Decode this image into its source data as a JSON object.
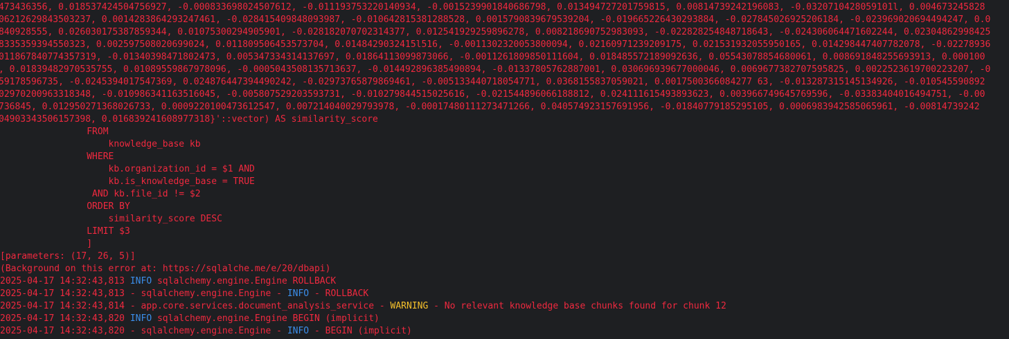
{
  "colors": {
    "background": "#1e1f22",
    "error_text": "#f0293f",
    "info": "#3b8eea",
    "warning": "#f5c02b"
  },
  "vector_lines": [
    "473436356, 0.018537424504756927, -0.000833698024507612, -0.011193753220140934, -0.0015239901840686798, 0.013494727201759815, 0.00814739242196083, -0.0320710428059101l, 0.004673245828",
    "06212629843503237, 0.0014283864293247461, -0.028415409848093987, -0.010642815381288528, 0.0015790839679539204, -0.019665226430293884, -0.027845026925206184, -0.023969020694494247, 0.0",
    "840928555, 0.026030175387859344, 0.01075300294905901, -0.028182070702314377, 0.012541929259896278, 0.008218690752983093, -0.022828254848718643, -0.024306064471602244, 0.02304862998425",
    "8335359394550323, 0.002597508020699024, 0.011809506453573704, 0.0148429032415l516, -0.0011302320053800094, 0.021609712392091‍75, 0.021531932055950165, 0.014298447407782078, -0.02278936",
    "011867840774357319, -0.01340398471802473, 0.005347334314137697, 0.0186411309987306‍6, -0.0011261809850111604, 0.018485572189092636, 0.05543078854680061, 0.008691848255693913, 0.000100",
    ", 0.01839482970535755, 0.01089559867978096, -0.0005043508135713637, -0.014492896385490894, -0.01337805762887001, 0.030696939677000046, 0.0069677382707595825, 0.0022523619700223207, -0",
    "59178596735, -0.0245394017547369, 0.024876447394490242, -0.02973765879869461, -0.005133440718054771, 0.0368155837059021, 0.0017500366084277 63, -0.013287315145134926, -0.010545590892",
    "02970200963318348, -0.010986341163516045, -0.005807529203593731, -0.010279844515025616, -0.021544896066188812, 0.024111615493893623, 0.003966749645769596, -0.03383404016494751, -0.00",
    "736845, 0.012950271368026733, 0.0009220100473612547, 0.007214040029793978, -0.00017480111273471266, 0.040574923157691956, -0.01840779185295105, 0.0006983942585065961, -0.00814739242",
    "04903343506157398, 0.016839241608977318}'::vector) AS similarity_score"
  ],
  "sql_lines": [
    "                FROM",
    "                    knowledge_base kb",
    "                WHERE",
    "                    kb.organization_id = $1 AND",
    "                    kb.is_knowledge_base = TRUE",
    "                 AND kb.file_id != $2",
    "                ORDER BY",
    "                    similarity_score DESC",
    "                LIMIT $3",
    "                ]"
  ],
  "parameters_line": "[parameters: (17, 26, 5)]",
  "background_line": {
    "prefix": "(Background on this ",
    "keyword": "error",
    "suffix": " at: https://sqlalche.me/e/20/dbapi)"
  },
  "log_lines": [
    {
      "timestamp": "2025-04-17 14:32:43,813 ",
      "level": "INFO",
      "message": " sqlalchemy.engine.Engine ROLLBACK",
      "style": "compact"
    },
    {
      "timestamp": "2025-04-17 14:32:43,813 - sqlalchemy.engine.Engine - ",
      "level": "INFO",
      "message": " - ROLLBACK",
      "style": "dashed"
    },
    {
      "timestamp": "2025-04-17 14:32:43,814 - app.core.services.document_analysis_service - ",
      "level": "WARNING",
      "message": " - No relevant knowledge base chunks found for chunk 12",
      "style": "warning"
    },
    {
      "timestamp": "2025-04-17 14:32:43,820 ",
      "level": "INFO",
      "message": " sqlalchemy.engine.Engine BEGIN (implicit)",
      "style": "compact"
    },
    {
      "timestamp": "2025-04-17 14:32:43,820 - sqlalchemy.engine.Engine - ",
      "level": "INFO",
      "message": " - BEGIN (implicit)",
      "style": "dashed"
    }
  ]
}
